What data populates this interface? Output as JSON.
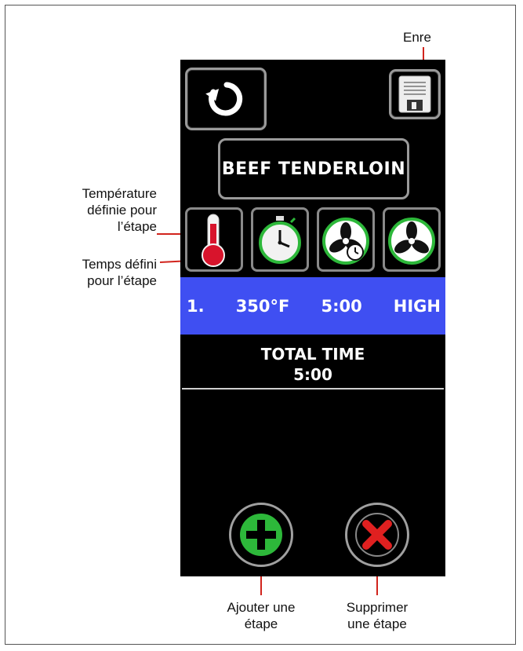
{
  "callouts": {
    "save": "Enre",
    "temperature": [
      "Température",
      "définie pour",
      "l’étape"
    ],
    "time": [
      "Temps défini",
      "pour l’étape"
    ],
    "add": [
      "Ajouter une",
      "étape"
    ],
    "delete": [
      "Supprimer",
      "une étape"
    ]
  },
  "screen": {
    "recipe_name": "BEEF TENDERLOIN",
    "step": {
      "number": "1.",
      "temperature": "350°F",
      "time": "5:00",
      "fan": "HIGH"
    },
    "total_label": "TOTAL TIME",
    "total_value": "5:00"
  },
  "icons": {
    "back": "back-arrow-icon",
    "save": "floppy-disk-icon",
    "temperature": "thermometer-icon",
    "timer": "stopwatch-icon",
    "fan_timer": "fan-timer-icon",
    "fan": "fan-icon",
    "add": "plus-icon",
    "delete": "x-icon"
  },
  "colors": {
    "step_row": "#3f4ff2",
    "add_green": "#2db83a",
    "delete_red": "#e02020",
    "callout_line": "#d1241d"
  }
}
